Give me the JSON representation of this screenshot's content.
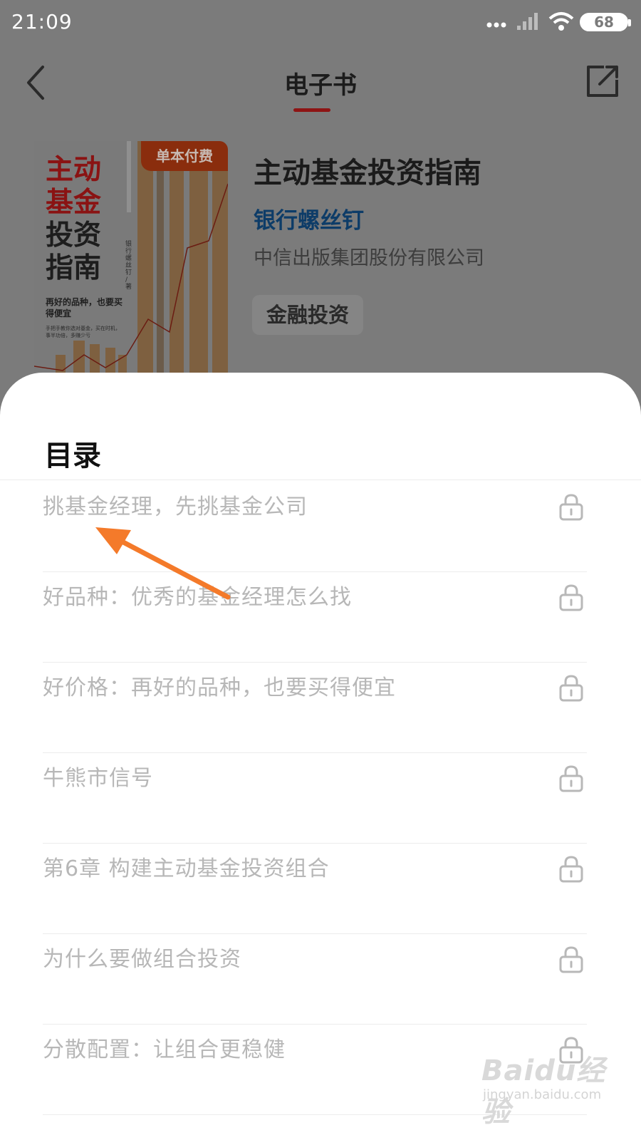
{
  "status_bar": {
    "time": "21:09",
    "battery": "68"
  },
  "nav": {
    "title": "电子书",
    "back_icon": "chevron-left-icon",
    "share_icon": "share-icon"
  },
  "book": {
    "badge": "单本付费",
    "title": "主动基金投资指南",
    "author": "银行螺丝钉",
    "publisher": "中信出版集团股份有限公司",
    "tag": "金融投资",
    "cover": {
      "title_line_1": "主动",
      "title_line_2": "基金",
      "title_line_3": "投资",
      "title_line_4": "指南",
      "subtitle": "再好的品种，也要买得便宜",
      "small_text": "手把手教你选对基金，买在时机，事半功倍，多赚少亏",
      "author_vertical": "银行螺丝钉 / 著"
    }
  },
  "toc": {
    "title": "目录",
    "items": [
      {
        "label": "挑基金经理，先挑基金公司"
      },
      {
        "label": "好品种：优秀的基金经理怎么找"
      },
      {
        "label": "好价格：再好的品种，也要买得便宜"
      },
      {
        "label": "牛熊市信号"
      },
      {
        "label": "第6章 构建主动基金投资组合"
      },
      {
        "label": "为什么要做组合投资"
      },
      {
        "label": "分散配置：让组合更稳健"
      }
    ]
  },
  "watermark": {
    "logo": "Baidu经验",
    "url": "jingyan.baidu.com"
  },
  "colors": {
    "accent_red": "#d7282b",
    "author_blue": "#1a78d0",
    "overlay": "#7b7b7b",
    "arrow": "#f47a2a"
  }
}
